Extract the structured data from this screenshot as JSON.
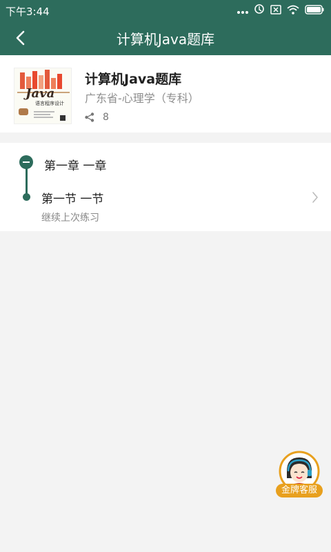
{
  "status_bar": {
    "time": "下午3:44"
  },
  "app_bar": {
    "title": "计算机Java题库",
    "back_icon": "chevron-left-icon"
  },
  "book": {
    "title": "计算机Java题库",
    "subtitle": "广东省-心理学（专科）",
    "share_count": "8",
    "cover_text": "Java",
    "cover_subtext": "语言程序设计"
  },
  "chapter": {
    "title": "第一章 一章",
    "section_title": "第一节 一节",
    "section_hint": "继续上次练习"
  },
  "service": {
    "label": "金牌客服"
  },
  "colors": {
    "primary": "#2d6c5c",
    "service_badge": "#e8a01e"
  }
}
